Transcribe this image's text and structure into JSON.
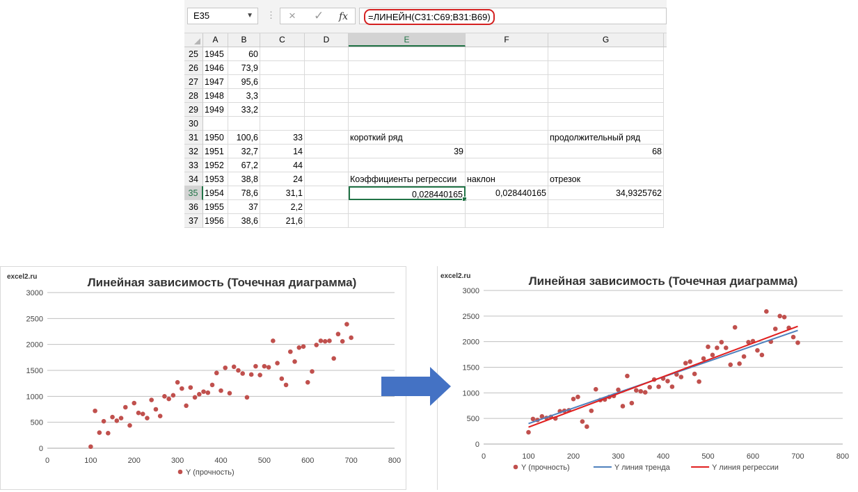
{
  "formula_bar": {
    "name_box": "E35",
    "name_box_icon": "chevron-down-icon",
    "cancel_icon": "×",
    "enter_icon": "✓",
    "fx_label": "fx",
    "formula": "=ЛИНЕЙН(C31:C69;B31:B69)"
  },
  "columns": [
    {
      "key": "A",
      "label": "A"
    },
    {
      "key": "B",
      "label": "B"
    },
    {
      "key": "C",
      "label": "C"
    },
    {
      "key": "D",
      "label": "D"
    },
    {
      "key": "E",
      "label": "E"
    },
    {
      "key": "F",
      "label": "F"
    },
    {
      "key": "G",
      "label": "G"
    }
  ],
  "active_column": "E",
  "active_row": "35",
  "rows": [
    {
      "num": "25",
      "A": "1945",
      "B": "60",
      "C": "",
      "E": "",
      "F": "",
      "G": ""
    },
    {
      "num": "26",
      "A": "1946",
      "B": "73,9",
      "C": "",
      "E": "",
      "F": "",
      "G": ""
    },
    {
      "num": "27",
      "A": "1947",
      "B": "95,6",
      "C": "",
      "E": "",
      "F": "",
      "G": ""
    },
    {
      "num": "28",
      "A": "1948",
      "B": "3,3",
      "C": "",
      "E": "",
      "F": "",
      "G": ""
    },
    {
      "num": "29",
      "A": "1949",
      "B": "33,2",
      "C": "",
      "E": "",
      "F": "",
      "G": ""
    },
    {
      "num": "30",
      "A": "",
      "B": "",
      "C": "",
      "E": "",
      "F": "",
      "G": ""
    },
    {
      "num": "31",
      "A": "1950",
      "B": "100,6",
      "C": "33",
      "E": "короткий ряд",
      "F": "",
      "G": "продолжительный ряд"
    },
    {
      "num": "32",
      "A": "1951",
      "B": "32,7",
      "C": "14",
      "E": "39",
      "F": "",
      "G": "68"
    },
    {
      "num": "33",
      "A": "1952",
      "B": "67,2",
      "C": "44",
      "E": "",
      "F": "",
      "G": ""
    },
    {
      "num": "34",
      "A": "1953",
      "B": "38,8",
      "C": "24",
      "E": "Коэффициенты регрессии",
      "F": "наклон",
      "G": "отрезок"
    },
    {
      "num": "35",
      "A": "1954",
      "B": "78,6",
      "C": "31,1",
      "E": "0,028440165",
      "F": "0,028440165",
      "G": "34,9325762"
    },
    {
      "num": "36",
      "A": "1955",
      "B": "37",
      "C": "2,2",
      "E": "",
      "F": "",
      "G": ""
    },
    {
      "num": "37",
      "A": "1956",
      "B": "38,6",
      "C": "21,6",
      "E": "",
      "F": "",
      "G": ""
    }
  ],
  "arrow_color": "#4472c4",
  "chart_data": [
    {
      "type": "scatter",
      "title": "Линейная зависимость (Точечная  диаграмма)",
      "watermark": "excel2.ru",
      "xlim": [
        0,
        800
      ],
      "ylim": [
        0,
        3000
      ],
      "x_ticks": [
        "0",
        "100",
        "200",
        "300",
        "400",
        "500",
        "600",
        "700",
        "800"
      ],
      "y_ticks": [
        "0",
        "500",
        "1000",
        "1500",
        "2000",
        "2500",
        "3000"
      ],
      "grid": true,
      "legend_position": "bottom",
      "series": [
        {
          "name": "Y (прочность)",
          "kind": "markers",
          "color": "#c0504d",
          "points": [
            [
              100,
              30
            ],
            [
              110,
              720
            ],
            [
              120,
              300
            ],
            [
              130,
              520
            ],
            [
              140,
              290
            ],
            [
              150,
              600
            ],
            [
              160,
              530
            ],
            [
              170,
              580
            ],
            [
              180,
              790
            ],
            [
              190,
              440
            ],
            [
              200,
              870
            ],
            [
              210,
              680
            ],
            [
              220,
              660
            ],
            [
              230,
              580
            ],
            [
              240,
              930
            ],
            [
              250,
              750
            ],
            [
              260,
              620
            ],
            [
              270,
              1000
            ],
            [
              280,
              950
            ],
            [
              290,
              1020
            ],
            [
              300,
              1270
            ],
            [
              310,
              1150
            ],
            [
              320,
              820
            ],
            [
              330,
              1170
            ],
            [
              340,
              980
            ],
            [
              350,
              1040
            ],
            [
              360,
              1090
            ],
            [
              370,
              1070
            ],
            [
              380,
              1220
            ],
            [
              390,
              1450
            ],
            [
              400,
              1110
            ],
            [
              410,
              1550
            ],
            [
              420,
              1060
            ],
            [
              430,
              1570
            ],
            [
              440,
              1500
            ],
            [
              450,
              1440
            ],
            [
              460,
              980
            ],
            [
              470,
              1420
            ],
            [
              480,
              1580
            ],
            [
              490,
              1410
            ],
            [
              500,
              1580
            ],
            [
              510,
              1560
            ],
            [
              520,
              2070
            ],
            [
              530,
              1640
            ],
            [
              540,
              1340
            ],
            [
              550,
              1220
            ],
            [
              560,
              1860
            ],
            [
              570,
              1670
            ],
            [
              580,
              1940
            ],
            [
              590,
              1960
            ],
            [
              600,
              1270
            ],
            [
              610,
              1480
            ],
            [
              620,
              1990
            ],
            [
              630,
              2070
            ],
            [
              640,
              2060
            ],
            [
              650,
              2070
            ],
            [
              660,
              1730
            ],
            [
              670,
              2200
            ],
            [
              680,
              2060
            ],
            [
              690,
              2390
            ],
            [
              700,
              2130
            ]
          ]
        }
      ]
    },
    {
      "type": "scatter",
      "title": "Линейная зависимость (Точечная  диаграмма)",
      "watermark": "excel2.ru",
      "xlim": [
        0,
        800
      ],
      "ylim": [
        0,
        3000
      ],
      "x_ticks": [
        "0",
        "100",
        "200",
        "300",
        "400",
        "500",
        "600",
        "700",
        "800"
      ],
      "y_ticks": [
        "0",
        "500",
        "1000",
        "1500",
        "2000",
        "2500",
        "3000"
      ],
      "grid": true,
      "legend_position": "bottom",
      "series": [
        {
          "name": "Y (прочность)",
          "kind": "markers",
          "color": "#c0504d",
          "points": [
            [
              100,
              230
            ],
            [
              110,
              490
            ],
            [
              120,
              470
            ],
            [
              130,
              540
            ],
            [
              140,
              510
            ],
            [
              150,
              530
            ],
            [
              160,
              500
            ],
            [
              170,
              640
            ],
            [
              180,
              650
            ],
            [
              190,
              660
            ],
            [
              200,
              880
            ],
            [
              210,
              920
            ],
            [
              220,
              440
            ],
            [
              230,
              340
            ],
            [
              240,
              650
            ],
            [
              250,
              1070
            ],
            [
              260,
              860
            ],
            [
              270,
              870
            ],
            [
              280,
              920
            ],
            [
              290,
              940
            ],
            [
              300,
              1060
            ],
            [
              310,
              740
            ],
            [
              320,
              1330
            ],
            [
              330,
              800
            ],
            [
              340,
              1050
            ],
            [
              350,
              1030
            ],
            [
              360,
              1010
            ],
            [
              370,
              1110
            ],
            [
              380,
              1260
            ],
            [
              390,
              1120
            ],
            [
              400,
              1280
            ],
            [
              410,
              1230
            ],
            [
              420,
              1120
            ],
            [
              430,
              1360
            ],
            [
              440,
              1310
            ],
            [
              450,
              1580
            ],
            [
              460,
              1610
            ],
            [
              470,
              1370
            ],
            [
              480,
              1220
            ],
            [
              490,
              1670
            ],
            [
              500,
              1900
            ],
            [
              510,
              1740
            ],
            [
              520,
              1880
            ],
            [
              530,
              1990
            ],
            [
              540,
              1880
            ],
            [
              550,
              1550
            ],
            [
              560,
              2280
            ],
            [
              570,
              1570
            ],
            [
              580,
              1710
            ],
            [
              590,
              1990
            ],
            [
              600,
              2010
            ],
            [
              610,
              1830
            ],
            [
              620,
              1740
            ],
            [
              630,
              2590
            ],
            [
              640,
              2000
            ],
            [
              650,
              2250
            ],
            [
              660,
              2500
            ],
            [
              670,
              2480
            ],
            [
              680,
              2270
            ],
            [
              690,
              2090
            ],
            [
              700,
              1980
            ]
          ]
        },
        {
          "name": "Y линия тренда",
          "kind": "line",
          "color": "#4f81bd",
          "points": [
            [
              100,
              400
            ],
            [
              700,
              2220
            ]
          ]
        },
        {
          "name": "Y линия регрессии",
          "kind": "line",
          "color": "#e02020",
          "points": [
            [
              100,
              330
            ],
            [
              700,
              2300
            ]
          ]
        }
      ]
    }
  ]
}
